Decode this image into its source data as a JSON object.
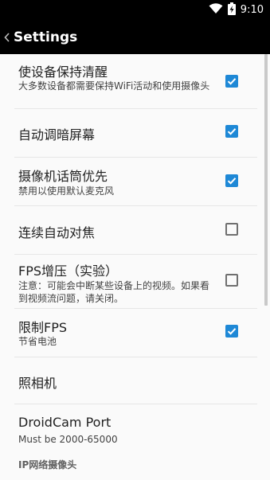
{
  "status_bar": {
    "time": "9:10"
  },
  "app_bar": {
    "title": "Settings"
  },
  "settings": [
    {
      "title": "使设备保持清醒",
      "summary": "大多数设备都需要保持WiFi活动和使用摄像头",
      "checked": true
    },
    {
      "title": "自动调暗屏幕",
      "summary": "",
      "checked": true
    },
    {
      "title": "摄像机话筒优先",
      "summary": "禁用以使用默认麦克风",
      "checked": true
    },
    {
      "title": "连续自动对焦",
      "summary": "",
      "checked": false
    },
    {
      "title": "FPS增压（实验）",
      "summary": "注意：可能会中断某些设备上的视频。如果看到视频流问题，请关闭。",
      "checked": false
    },
    {
      "title": "限制FPS",
      "summary": "节省电池",
      "checked": true
    },
    {
      "title": "照相机",
      "summary": ""
    },
    {
      "title": "DroidCam Port",
      "summary": "Must be 2000-65000"
    }
  ],
  "section_header": "IP网络摄像头",
  "colors": {
    "accent": "#1e88d6",
    "background": "#fafafa",
    "app_bar": "#000000"
  },
  "icons": [
    "wifi-icon",
    "battery-charging-icon",
    "back-chevron-icon",
    "checkbox-checked-icon"
  ]
}
